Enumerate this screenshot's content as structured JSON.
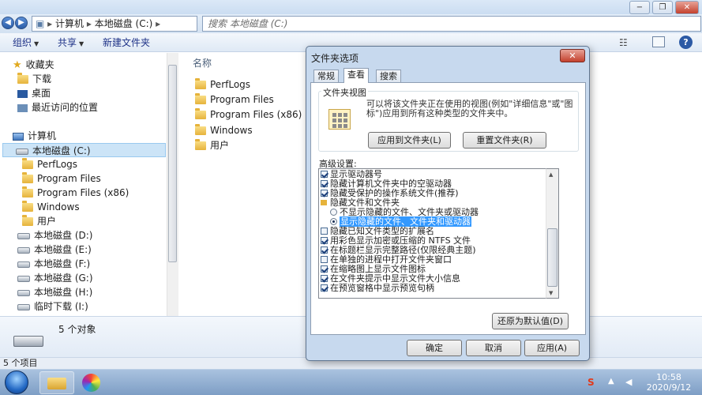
{
  "window": {
    "address_parts": [
      "计算机",
      "本地磁盘 (C:)"
    ],
    "search_placeholder": "搜索 本地磁盘 (C:)",
    "controls": {
      "minimize": "−",
      "maximize": "❐",
      "close": "✕"
    }
  },
  "toolbar": {
    "organize": "组织",
    "share": "共享",
    "new_folder": "新建文件夹"
  },
  "nav": {
    "favorites": "收藏夹",
    "fav_items": [
      "下载",
      "桌面",
      "最近访问的位置"
    ],
    "computer": "计算机",
    "drive_c": "本地磁盘 (C:)",
    "c_children": [
      "PerfLogs",
      "Program Files",
      "Program Files (x86)",
      "Windows",
      "用户"
    ],
    "drives": [
      "本地磁盘 (D:)",
      "本地磁盘 (E:)",
      "本地磁盘 (F:)",
      "本地磁盘 (G:)",
      "本地磁盘 (H:)",
      "临时下载 (I:)"
    ]
  },
  "content": {
    "col_name": "名称",
    "items": [
      "PerfLogs",
      "Program Files",
      "Program Files (x86)",
      "Windows",
      "用户"
    ]
  },
  "details": {
    "count": "5 个对象"
  },
  "status": {
    "text": "5 个项目"
  },
  "dialog": {
    "title": "文件夹选项",
    "close": "✕",
    "tabs": [
      "常规",
      "查看",
      "搜索"
    ],
    "folder_view_legend": "文件夹视图",
    "folder_view_desc": "可以将该文件夹正在使用的视图(例如\"详细信息\"或\"图标\")应用到所有这种类型的文件夹中。",
    "apply_to_folders": "应用到文件夹(L)",
    "reset_folders": "重置文件夹(R)",
    "advanced_label": "高级设置:",
    "advanced": [
      {
        "kind": "check",
        "on": true,
        "text": "显示驱动器号"
      },
      {
        "kind": "check",
        "on": true,
        "text": "隐藏计算机文件夹中的空驱动器"
      },
      {
        "kind": "check",
        "on": true,
        "text": "隐藏受保护的操作系统文件(推荐)"
      },
      {
        "kind": "folder",
        "text": "隐藏文件和文件夹"
      },
      {
        "kind": "radio",
        "on": false,
        "text": "不显示隐藏的文件、文件夹或驱动器"
      },
      {
        "kind": "radio",
        "on": true,
        "text": "显示隐藏的文件、文件夹和驱动器",
        "selected": true
      },
      {
        "kind": "check",
        "on": false,
        "text": "隐藏已知文件类型的扩展名"
      },
      {
        "kind": "check",
        "on": true,
        "text": "用彩色显示加密或压缩的 NTFS 文件"
      },
      {
        "kind": "check",
        "on": true,
        "text": "在标题栏显示完整路径(仅限经典主题)"
      },
      {
        "kind": "check",
        "on": false,
        "text": "在单独的进程中打开文件夹窗口"
      },
      {
        "kind": "check",
        "on": true,
        "text": "在缩略图上显示文件图标"
      },
      {
        "kind": "check",
        "on": true,
        "text": "在文件夹提示中显示文件大小信息"
      },
      {
        "kind": "check",
        "on": true,
        "text": "在预览窗格中显示预览句柄"
      }
    ],
    "restore_defaults": "还原为默认值(D)",
    "ok": "确定",
    "cancel": "取消",
    "apply": "应用(A)"
  },
  "taskbar": {
    "time": "10:58",
    "date": "2020/9/12"
  }
}
